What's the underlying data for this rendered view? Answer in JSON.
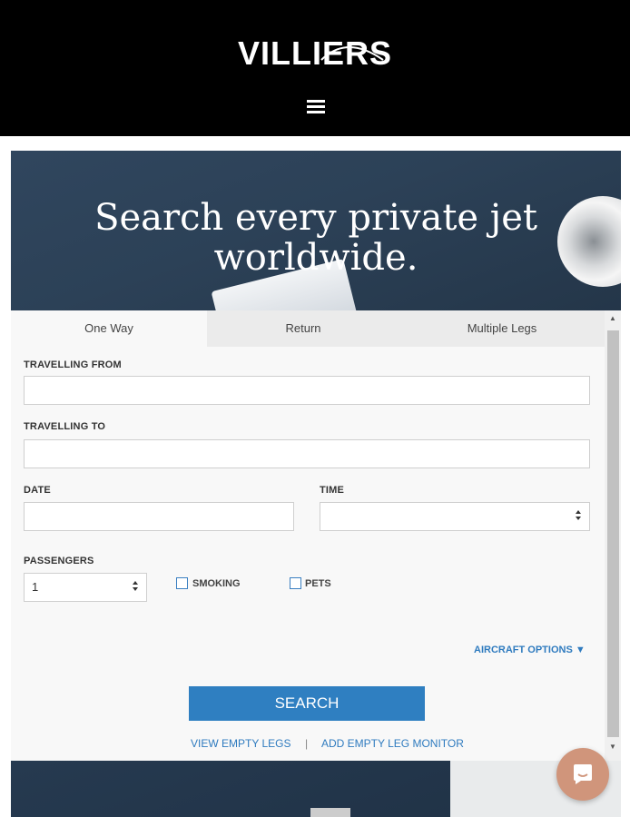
{
  "header": {
    "logo_text": "VILLIERS",
    "menu_icon": "hamburger-icon"
  },
  "hero": {
    "title_line1": "Search every private jet",
    "title_line2": "worldwide."
  },
  "tabs": [
    {
      "label": "One Way",
      "active": true
    },
    {
      "label": "Return",
      "active": false
    },
    {
      "label": "Multiple Legs",
      "active": false
    }
  ],
  "form": {
    "from_label": "TRAVELLING FROM",
    "from_value": "",
    "to_label": "TRAVELLING TO",
    "to_value": "",
    "date_label": "DATE",
    "date_value": "",
    "time_label": "TIME",
    "time_value": "",
    "passengers_label": "PASSENGERS",
    "passengers_value": "1",
    "smoking_label": "SMOKING",
    "smoking_checked": false,
    "pets_label": "PETS",
    "pets_checked": false,
    "aircraft_options_label": "AIRCRAFT OPTIONS ▼",
    "search_label": "SEARCH",
    "view_empty_legs": "VIEW EMPTY LEGS",
    "separator": "|",
    "add_empty_leg_monitor": "ADD EMPTY LEG MONITOR"
  },
  "colors": {
    "accent": "#2f7fc1",
    "header_bg": "#000000",
    "chat_bubble": "#d0957b"
  },
  "chat": {
    "icon": "chat-bubble-icon"
  }
}
